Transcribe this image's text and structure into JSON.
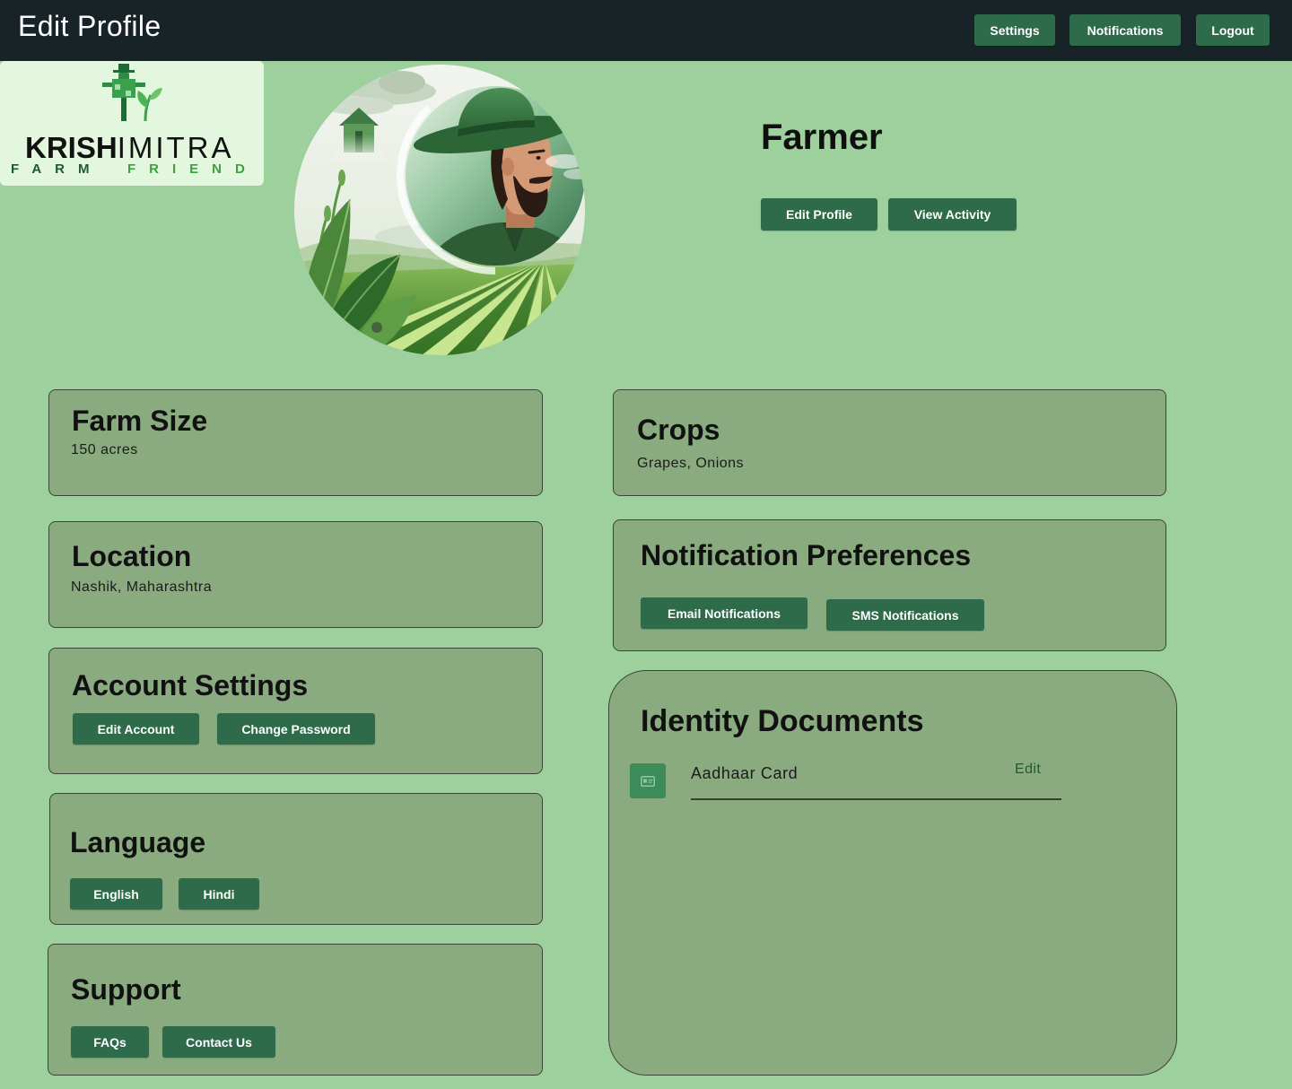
{
  "header": {
    "title": "Edit Profile",
    "settings_label": "Settings",
    "notifications_label": "Notifications",
    "logout_label": "Logout"
  },
  "logo": {
    "icon": "scarecrow-logo-icon",
    "wordmark_bold": "KRISH",
    "wordmark_light": "IMITRA",
    "tagline_first": "FARM",
    "tagline_second": "FRIEND"
  },
  "profile": {
    "name": "Farmer",
    "edit_profile_label": "Edit Profile",
    "view_activity_label": "View Activity"
  },
  "farm_size": {
    "title": "Farm Size",
    "value": "150 acres"
  },
  "location": {
    "title": "Location",
    "value": "Nashik, Maharashtra"
  },
  "account_settings": {
    "title": "Account Settings",
    "edit_account_label": "Edit Account",
    "change_password_label": "Change Password"
  },
  "language": {
    "title": "Language",
    "options": [
      "English",
      "Hindi"
    ]
  },
  "support": {
    "title": "Support",
    "faqs_label": "FAQs",
    "contact_label": "Contact Us"
  },
  "crops": {
    "title": "Crops",
    "value": "Grapes, Onions"
  },
  "notification_preferences": {
    "title": "Notification Preferences",
    "email_label": "Email Notifications",
    "sms_label": "SMS Notifications"
  },
  "identity_documents": {
    "title": "Identity Documents",
    "documents": [
      {
        "name": "Aadhaar Card",
        "action": "Edit",
        "icon": "id-card-icon"
      }
    ]
  },
  "theme": {
    "header_bg": "#172326",
    "page_bg": "#9ed09d",
    "card_bg": "#8aab7f",
    "button_bg": "#2d6b4a",
    "logo_bg": "#e2f7de"
  }
}
